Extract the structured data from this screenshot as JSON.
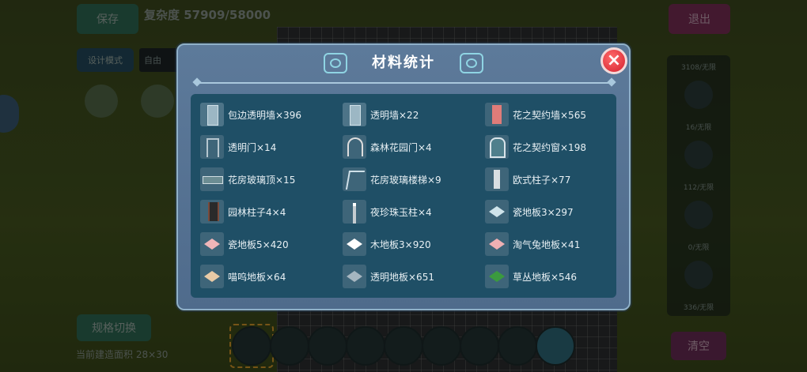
{
  "background": {
    "save_label": "保存",
    "complexity": "复杂度 57909/58000",
    "design_label": "设计模式",
    "name_placeholder": "自由",
    "exit_label": "退出",
    "spec_label": "规格切换",
    "clear_label": "清空",
    "area_text": "当前建造面积 28×30",
    "right_panel": [
      "3108/无限",
      "16/无限",
      "112/无限",
      "0/无限",
      "336/无限"
    ]
  },
  "dialog": {
    "title": "材料统计",
    "close_icon": "close-icon",
    "accent": "#d4202e",
    "items": [
      {
        "name": "包边透明墙×396",
        "icon": "transparent-wall-edge-icon"
      },
      {
        "name": "透明墙×22",
        "icon": "transparent-wall-icon"
      },
      {
        "name": "花之契约墙×565",
        "icon": "flower-wall-icon"
      },
      {
        "name": "透明门×14",
        "icon": "transparent-door-icon"
      },
      {
        "name": "森林花园门×4",
        "icon": "forest-garden-door-icon"
      },
      {
        "name": "花之契约窗×198",
        "icon": "flower-window-icon"
      },
      {
        "name": "花房玻璃顶×15",
        "icon": "glass-roof-icon"
      },
      {
        "name": "花房玻璃楼梯×9",
        "icon": "glass-stair-icon"
      },
      {
        "name": "欧式柱子×77",
        "icon": "european-pillar-icon"
      },
      {
        "name": "园林柱子4×4",
        "icon": "garden-pillar-icon"
      },
      {
        "name": "夜珍珠玉柱×4",
        "icon": "pearl-pillar-icon"
      },
      {
        "name": "瓷地板3×297",
        "icon": "tile-floor-icon"
      },
      {
        "name": "瓷地板5×420",
        "icon": "tile-floor-pink-icon"
      },
      {
        "name": "木地板3×920",
        "icon": "wood-floor-icon"
      },
      {
        "name": "淘气兔地板×41",
        "icon": "rabbit-floor-icon"
      },
      {
        "name": "喵呜地板×64",
        "icon": "meow-floor-icon"
      },
      {
        "name": "透明地板×651",
        "icon": "transparent-floor-icon"
      },
      {
        "name": "草丛地板×546",
        "icon": "grass-floor-icon"
      }
    ]
  }
}
